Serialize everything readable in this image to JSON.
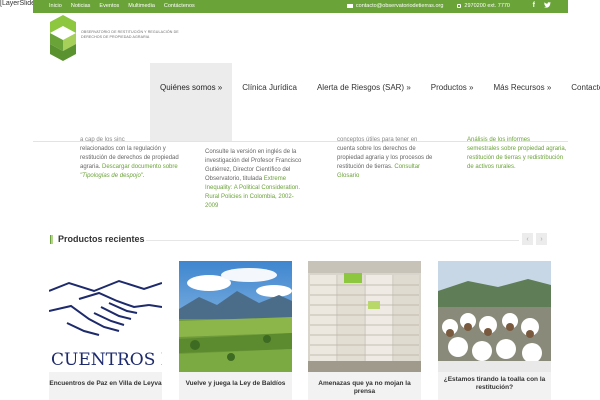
{
  "layerslider": "[LayerSlider",
  "topbar": {
    "links": [
      "Inicio",
      "Noticias",
      "Eventos",
      "Multimedia",
      "Contáctenos"
    ],
    "email": "contacto@observatoriodetierras.org",
    "phone": "2970200 ext. 7770",
    "social": [
      "facebook-icon",
      "twitter-icon"
    ]
  },
  "logo": {
    "text": "OBSERVATORIO DE RESTITUCIÓN Y REGULACIÓN DE DERECHOS DE PROPIEDAD AGRARIA"
  },
  "nav": [
    "Quiénes somos »",
    "Clínica Jurídica",
    "Alerta de Riesgos (SAR) »",
    "Productos »",
    "Más Recursos »",
    "Contacto"
  ],
  "columns": {
    "c1": {
      "frag": "a cap de los sinc",
      "text": "relacionados con la regulación y restitución de derechos de propiedad agraria.",
      "link": "Descargar documento sobre",
      "italic": "\"Tipologías de despojo\"",
      "tail": "."
    },
    "c2": {
      "text": "Consulte la versión en inglés de la investigación del Profesor Francisco Gutiérrez, Director Científico del Observatorio, titulada",
      "link": "Extreme Inequality: A Political Consideration. Rural Policies in Colombia, 2002-2009"
    },
    "c3": {
      "frag": "conceptos útiles para tener en",
      "text": "cuenta sobre los derechos de propiedad agraria y los procesos de restitución de tierras.",
      "link": "Consultar Glosario"
    },
    "c4": {
      "frag": "Análisis de los informes",
      "text": "semestrales sobre propiedad agraria, restitución de tierras y redistribución de activos rurales."
    }
  },
  "section": {
    "title": "Productos recientes",
    "prev": "‹",
    "next": "›"
  },
  "products": [
    {
      "caption": "Encuentros de Paz en Villa de Leyva",
      "img_text": "CUENTROS DE P"
    },
    {
      "caption": "Vuelve y juega la Ley de Baldíos"
    },
    {
      "caption": "Amenazas que ya no mojan la prensa"
    },
    {
      "caption": "¿Estamos tirando la toalla con la restitución?"
    }
  ],
  "colors": {
    "brand_green": "#6aa338",
    "nav_active_bg": "#ececec",
    "caption_bg": "#f2f2f2"
  }
}
